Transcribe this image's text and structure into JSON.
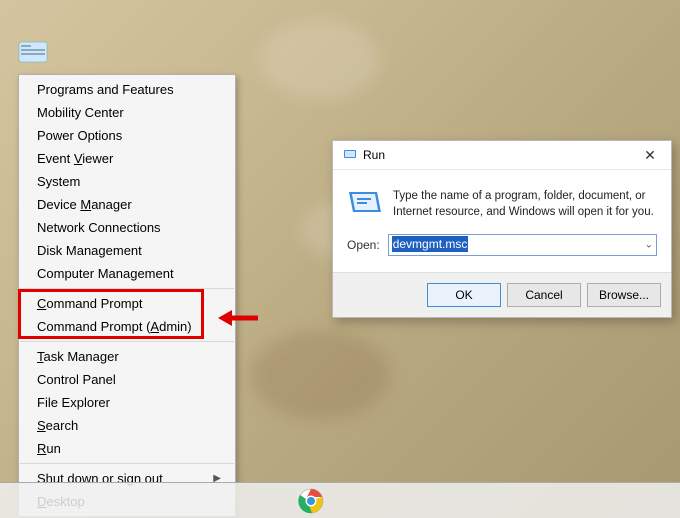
{
  "context_menu": {
    "items": [
      {
        "label": "Programs and Features",
        "accel": ""
      },
      {
        "label": "Mobility Center",
        "accel": ""
      },
      {
        "label": "Power Options",
        "accel": ""
      },
      {
        "label": "Event Viewer",
        "accel": "V"
      },
      {
        "label": "System",
        "accel": "Y"
      },
      {
        "label": "Device Manager",
        "accel": "M"
      },
      {
        "label": "Network Connections",
        "accel": ""
      },
      {
        "label": "Disk Management",
        "accel": ""
      },
      {
        "label": "Computer Management",
        "accel": ""
      }
    ],
    "cmd_group": [
      {
        "label": "Command Prompt",
        "accel": "C"
      },
      {
        "label": "Command Prompt (Admin)",
        "accel": "A"
      }
    ],
    "items2": [
      {
        "label": "Task Manager",
        "accel": "T"
      },
      {
        "label": "Control Panel",
        "accel": ""
      },
      {
        "label": "File Explorer",
        "accel": ""
      },
      {
        "label": "Search",
        "accel": "S"
      },
      {
        "label": "Run",
        "accel": "R"
      }
    ],
    "items3": [
      {
        "label": "Shut down or sign out",
        "submenu": true
      },
      {
        "label": "Desktop",
        "accel": "D"
      }
    ]
  },
  "run_dialog": {
    "title": "Run",
    "description": "Type the name of a program, folder, document, or Internet resource, and Windows will open it for you.",
    "open_label": "Open:",
    "open_value": "devmgmt.msc",
    "buttons": {
      "ok": "OK",
      "cancel": "Cancel",
      "browse": "Browse..."
    }
  }
}
